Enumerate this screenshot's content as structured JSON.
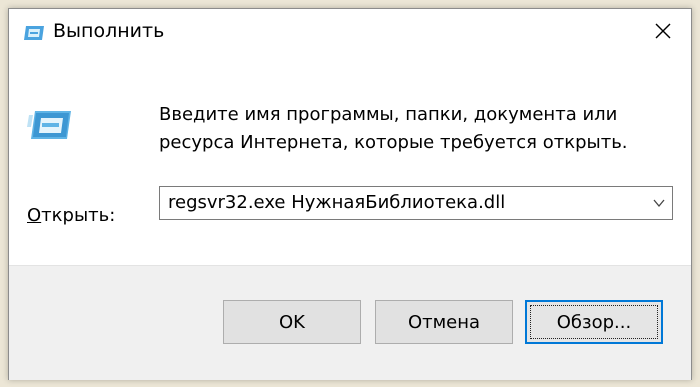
{
  "window": {
    "title": "Выполнить",
    "title_icon": "run-app-icon",
    "close_icon": "close-icon"
  },
  "content": {
    "app_icon": "run-dialog-icon",
    "description": "Введите имя программы, папки, документа или ресурса Интернета, которые требуется открыть.",
    "open_label_accel": "О",
    "open_label_rest": "ткрыть:",
    "open_value": "regsvr32.exe НужнаяБиблиотека.dll",
    "dropdown_icon": "chevron-down-icon"
  },
  "buttons": {
    "ok": "OK",
    "cancel": "Отмена",
    "browse": "Обзор..."
  },
  "colors": {
    "focus_border": "#0078d7",
    "footer_bg": "#f0f0f0",
    "button_bg": "#e1e1e1"
  }
}
